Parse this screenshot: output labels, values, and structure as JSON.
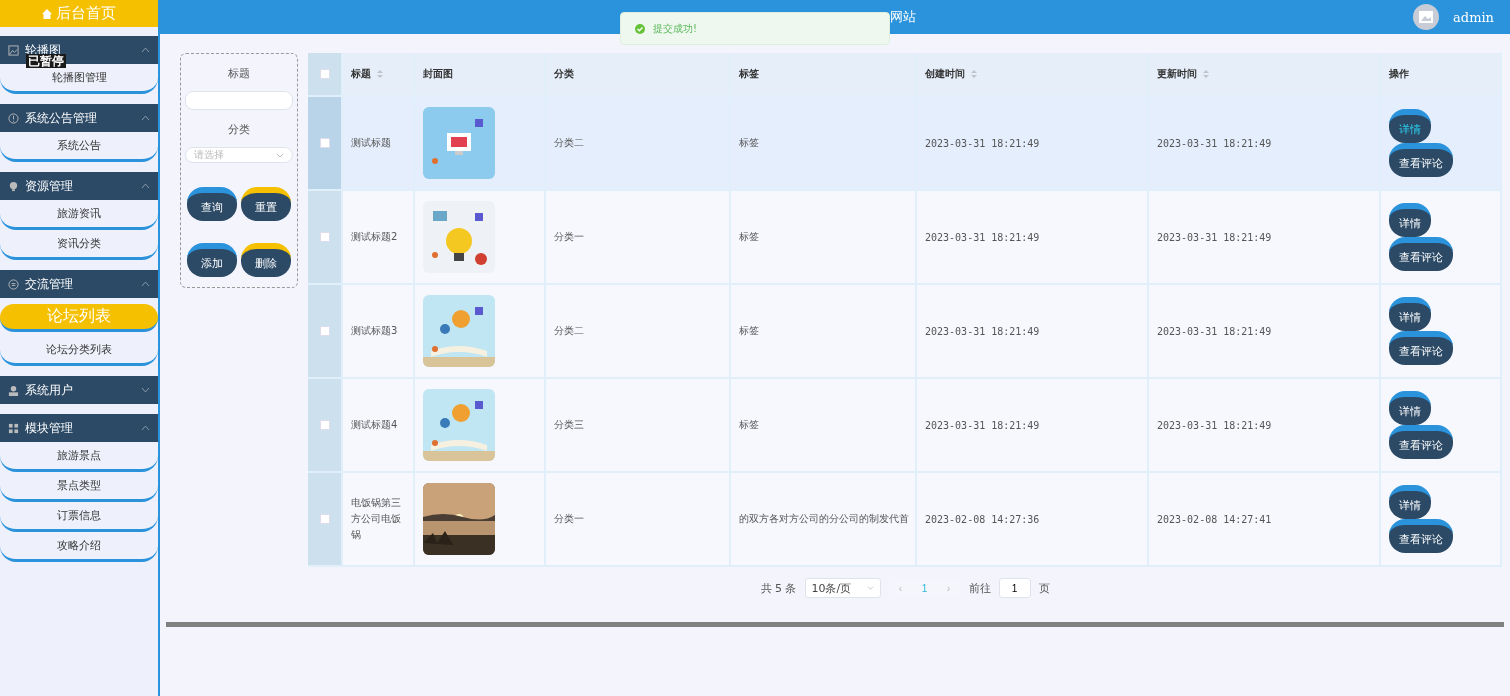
{
  "sidebar": {
    "home": {
      "label": "后台首页"
    },
    "groups": [
      {
        "label": "轮播图",
        "expanded": true,
        "children": [
          {
            "label": "轮播图管理",
            "selected": false
          }
        ]
      },
      {
        "label": "系统公告管理",
        "expanded": true,
        "children": [
          {
            "label": "系统公告",
            "selected": false
          }
        ]
      },
      {
        "label": "资源管理",
        "expanded": true,
        "children": [
          {
            "label": "旅游资讯",
            "selected": false
          },
          {
            "label": "资讯分类",
            "selected": false
          }
        ]
      },
      {
        "label": "交流管理",
        "expanded": true,
        "children": [
          {
            "label": "论坛列表",
            "selected": true
          },
          {
            "label": "论坛分类列表",
            "selected": false
          }
        ]
      },
      {
        "label": "系统用户",
        "expanded": false
      },
      {
        "label": "模块管理",
        "expanded": true,
        "children": [
          {
            "label": "旅游景点",
            "selected": false
          },
          {
            "label": "景点类型",
            "selected": false
          },
          {
            "label": "订票信息",
            "selected": false
          },
          {
            "label": "攻略介绍",
            "selected": false
          }
        ]
      }
    ]
  },
  "overlay_text": "已暂停",
  "header": {
    "title": "网站",
    "user": "admin"
  },
  "toast": {
    "message": "提交成功!"
  },
  "filter": {
    "title_label": "标题",
    "category_label": "分类",
    "category_placeholder": "请选择",
    "buttons": [
      {
        "label": "查询",
        "color": "#2a93dc"
      },
      {
        "label": "重置",
        "color": "#f5c000"
      },
      {
        "label": "添加",
        "color": "#2a93dc"
      },
      {
        "label": "删除",
        "color": "#f5c000"
      }
    ]
  },
  "table": {
    "select_all_checked": false,
    "columns": [
      {
        "label": "标题",
        "sortable": true
      },
      {
        "label": "封面图",
        "sortable": false
      },
      {
        "label": "分类",
        "sortable": false
      },
      {
        "label": "标签",
        "sortable": false
      },
      {
        "label": "创建时间",
        "sortable": true
      },
      {
        "label": "更新时间",
        "sortable": true
      },
      {
        "label": "操作",
        "sortable": false
      }
    ],
    "rows": [
      {
        "checked": false,
        "highlighted": true,
        "title": "测试标题",
        "category": "分类二",
        "tag": "标签",
        "created": "2023-03-31 18:21:49",
        "updated": "2023-03-31 18:21:49",
        "actions": [
          {
            "label": "详情",
            "hovered": true
          },
          {
            "label": "查看评论",
            "hovered": false
          }
        ]
      },
      {
        "checked": false,
        "highlighted": false,
        "title": "测试标题2",
        "category": "分类一",
        "tag": "标签",
        "created": "2023-03-31 18:21:49",
        "updated": "2023-03-31 18:21:49",
        "actions": [
          {
            "label": "详情",
            "hovered": false
          },
          {
            "label": "查看评论",
            "hovered": false
          }
        ]
      },
      {
        "checked": false,
        "highlighted": false,
        "title": "测试标题3",
        "category": "分类二",
        "tag": "标签",
        "created": "2023-03-31 18:21:49",
        "updated": "2023-03-31 18:21:49",
        "actions": [
          {
            "label": "详情",
            "hovered": false
          },
          {
            "label": "查看评论",
            "hovered": false
          }
        ]
      },
      {
        "checked": false,
        "highlighted": false,
        "title": "测试标题4",
        "category": "分类三",
        "tag": "标签",
        "created": "2023-03-31 18:21:49",
        "updated": "2023-03-31 18:21:49",
        "actions": [
          {
            "label": "详情",
            "hovered": false
          },
          {
            "label": "查看评论",
            "hovered": false
          }
        ]
      },
      {
        "checked": false,
        "highlighted": false,
        "title": "电饭锅第三方公司电饭锅",
        "category": "分类一",
        "tag": "的双方各对方公司的分公司的制发代首",
        "created": "2023-02-08 14:27:36",
        "updated": "2023-02-08 14:27:41",
        "actions": [
          {
            "label": "详情",
            "hovered": false
          },
          {
            "label": "查看评论",
            "hovered": false
          }
        ]
      }
    ]
  },
  "pagination": {
    "total": "共 5 条",
    "page_size": "10条/页",
    "prev": "‹",
    "pages": [
      {
        "label": "1",
        "selected": true
      }
    ],
    "next": "›",
    "goto_label": "前往",
    "goto_value": "1",
    "goto_suffix": "页"
  }
}
